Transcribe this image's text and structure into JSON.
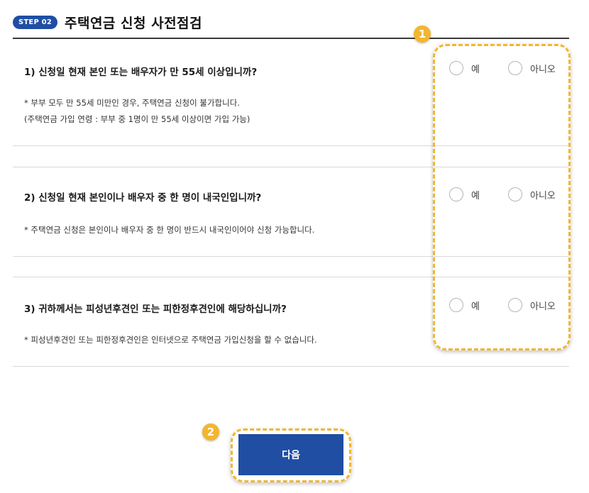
{
  "header": {
    "step_badge": "STEP 02",
    "title": "주택연금 신청 사전점검"
  },
  "questions": [
    {
      "text": "1) 신청일 현재 본인 또는 배우자가 만 55세 이상입니까?",
      "notes": [
        "* 부부 모두 만 55세 미만인 경우, 주택연금 신청이 불가합니다.",
        "(주택연금 가입 연령 : 부부 중 1명이 만 55세 이상이면 가입 가능)"
      ],
      "options": [
        "예",
        "아니오"
      ]
    },
    {
      "text": "2) 신청일 현재 본인이나 배우자 중 한 명이 내국인입니까?",
      "notes": [
        "* 주택연금 신청은 본인이나 배우자 중 한 명이 반드시 내국인이어야 신청 가능합니다."
      ],
      "options": [
        "예",
        "아니오"
      ]
    },
    {
      "text": "3) 귀하께서는 피성년후견인 또는 피한정후견인에 해당하십니까?",
      "notes": [
        "* 피성년후견인 또는 피한정후견인은 인터넷으로 주택연금 가입신청을 할 수 없습니다."
      ],
      "options": [
        "예",
        "아니오"
      ]
    }
  ],
  "annotations": {
    "marker_1": "1",
    "marker_2": "2"
  },
  "actions": {
    "next_label": "다음"
  },
  "colors": {
    "primary": "#1f4ea3",
    "highlight": "#f2b630"
  }
}
